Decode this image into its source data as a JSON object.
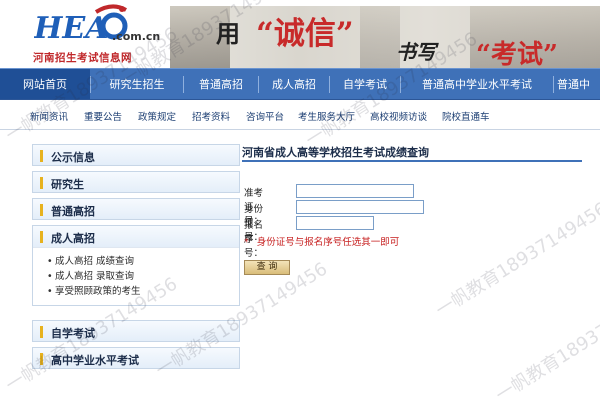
{
  "header": {
    "logo_mark": "HEAO",
    "logo_domain": ".com.cn",
    "logo_subtitle": "河南招生考试信息网",
    "banner": {
      "word1": "用",
      "word2": "“诚信”",
      "word3": "书写",
      "word4": "“考试”"
    }
  },
  "nav": {
    "items": [
      {
        "label": "网站首页"
      },
      {
        "label": "研究生招生"
      },
      {
        "label": "普通高招"
      },
      {
        "label": "成人高招"
      },
      {
        "label": "自学考试"
      },
      {
        "label": "普通高中学业水平考试"
      },
      {
        "label": "普通中"
      }
    ]
  },
  "subnav": {
    "items": [
      {
        "label": "新闻资讯"
      },
      {
        "label": "重要公告"
      },
      {
        "label": "政策规定"
      },
      {
        "label": "招考资料"
      },
      {
        "label": "咨询平台"
      },
      {
        "label": "考生服务大厅"
      },
      {
        "label": "高校视频访谈"
      },
      {
        "label": "院校直通车"
      }
    ]
  },
  "sidebar": {
    "sections": [
      {
        "label": "公示信息"
      },
      {
        "label": "研究生"
      },
      {
        "label": "普通高招"
      },
      {
        "label": "成人高招"
      },
      {
        "label": "自学考试"
      },
      {
        "label": "高中学业水平考试"
      }
    ],
    "open_links": [
      {
        "label": "成人高招 成绩查询"
      },
      {
        "label": "成人高招 录取查询"
      },
      {
        "label": "享受照顾政策的考生"
      }
    ],
    "bullet": "•"
  },
  "main": {
    "title": "河南省成人高等学校招生考试成绩查询",
    "fields": [
      {
        "label": "准考证号：",
        "value": ""
      },
      {
        "label": "身份证号：",
        "value": ""
      },
      {
        "label": "报名序号：",
        "value": ""
      }
    ],
    "note_marker": "*",
    "note": "身份证号与报名序号任选其一即可",
    "query_button": "查 询"
  },
  "watermark": "一帆教育18937149456",
  "colors": {
    "nav_bg": "#3f71b8",
    "nav_active": "#1f4f96",
    "accent_red": "#c61d1d",
    "side_bar": "#e7b21e"
  }
}
